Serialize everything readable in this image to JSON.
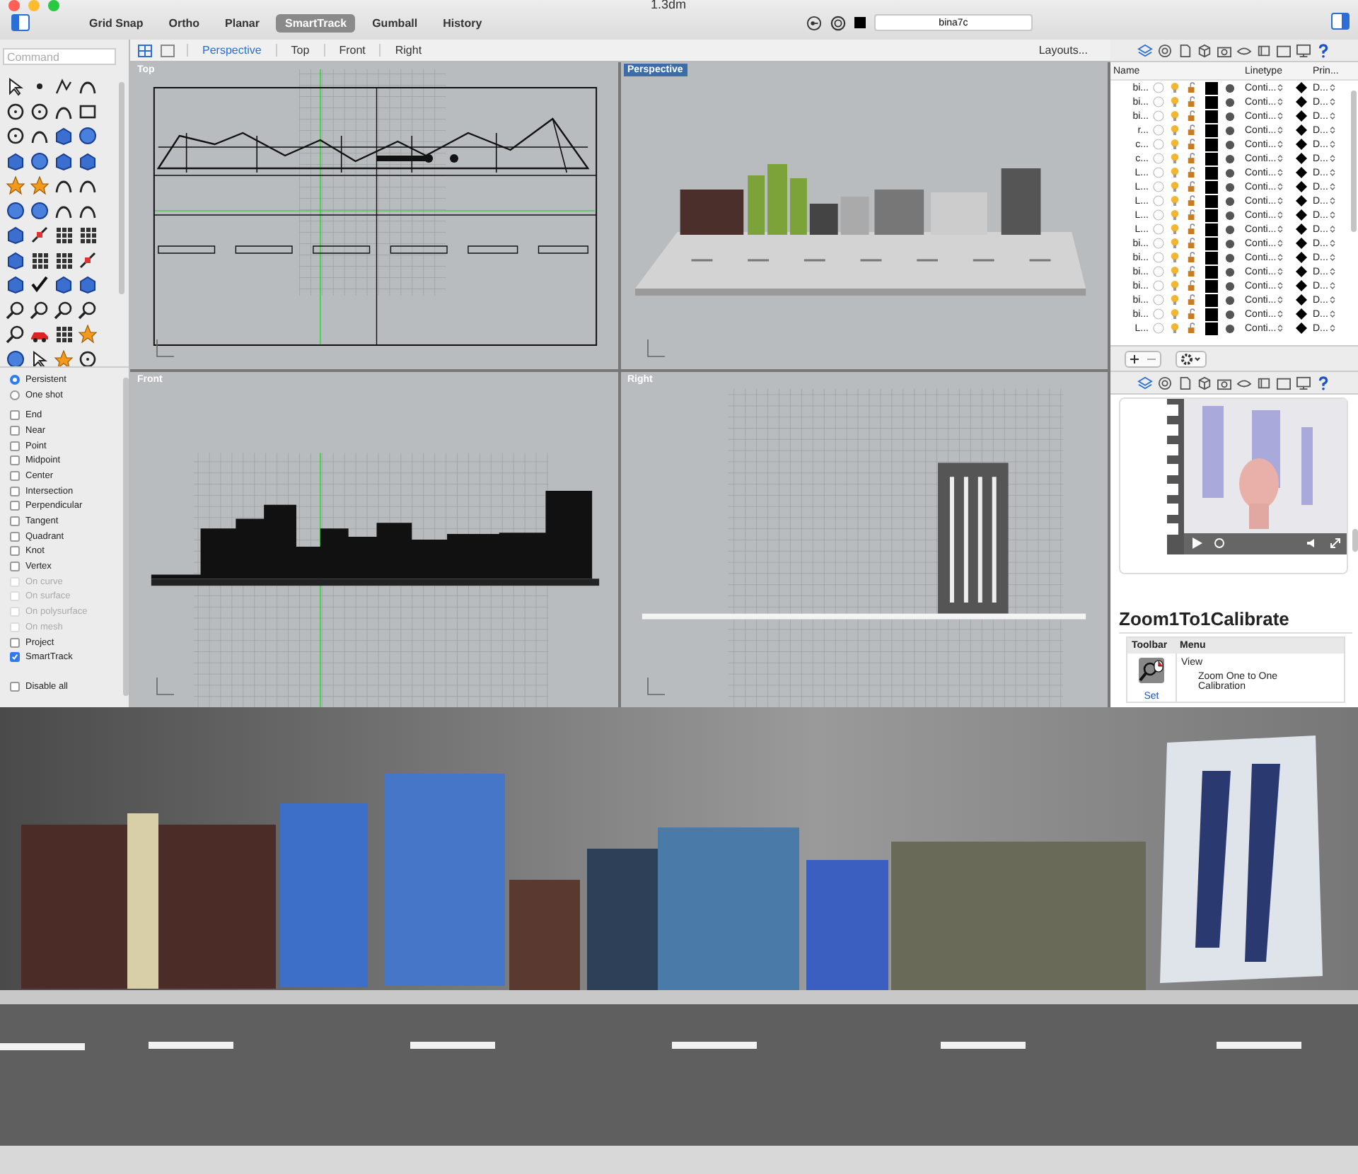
{
  "window": {
    "title": "1.3dm"
  },
  "toolbar": {
    "toggles": [
      {
        "label": "Grid Snap",
        "on": false
      },
      {
        "label": "Ortho",
        "on": false
      },
      {
        "label": "Planar",
        "on": false
      },
      {
        "label": "SmartTrack",
        "on": true
      },
      {
        "label": "Gumball",
        "on": false
      },
      {
        "label": "History",
        "on": false
      }
    ],
    "layer_field": {
      "value": "bina7c"
    }
  },
  "view_tabs": [
    {
      "label": "Perspective",
      "selected": true
    },
    {
      "label": "Top",
      "selected": false
    },
    {
      "label": "Front",
      "selected": false
    },
    {
      "label": "Right",
      "selected": false
    }
  ],
  "layouts_button": "Layouts...",
  "command": {
    "placeholder": "Command"
  },
  "osnaps": [
    {
      "kind": "radio",
      "label": "Persistent",
      "selected": true
    },
    {
      "kind": "radio",
      "label": "One shot",
      "selected": false
    },
    {
      "kind": "checkbox",
      "label": "End",
      "checked": false,
      "disabled": false
    },
    {
      "kind": "checkbox",
      "label": "Near",
      "checked": false,
      "disabled": false
    },
    {
      "kind": "checkbox",
      "label": "Point",
      "checked": false,
      "disabled": false
    },
    {
      "kind": "checkbox",
      "label": "Midpoint",
      "checked": false,
      "disabled": false
    },
    {
      "kind": "checkbox",
      "label": "Center",
      "checked": false,
      "disabled": false
    },
    {
      "kind": "checkbox",
      "label": "Intersection",
      "checked": false,
      "disabled": false
    },
    {
      "kind": "checkbox",
      "label": "Perpendicular",
      "checked": false,
      "disabled": false
    },
    {
      "kind": "checkbox",
      "label": "Tangent",
      "checked": false,
      "disabled": false
    },
    {
      "kind": "checkbox",
      "label": "Quadrant",
      "checked": false,
      "disabled": false
    },
    {
      "kind": "checkbox",
      "label": "Knot",
      "checked": false,
      "disabled": false
    },
    {
      "kind": "checkbox",
      "label": "Vertex",
      "checked": false,
      "disabled": false
    },
    {
      "kind": "checkbox",
      "label": "On curve",
      "checked": false,
      "disabled": true
    },
    {
      "kind": "checkbox",
      "label": "On surface",
      "checked": false,
      "disabled": true
    },
    {
      "kind": "checkbox",
      "label": "On polysurface",
      "checked": false,
      "disabled": true
    },
    {
      "kind": "checkbox",
      "label": "On mesh",
      "checked": false,
      "disabled": true
    },
    {
      "kind": "checkbox",
      "label": "Project",
      "checked": false,
      "disabled": false
    },
    {
      "kind": "checkbox",
      "label": "SmartTrack",
      "checked": true,
      "disabled": false
    },
    {
      "kind": "checkbox",
      "label": "Disable all",
      "checked": false,
      "disabled": false
    }
  ],
  "viewports": [
    {
      "title": "Top",
      "kind": "plan",
      "selected": false
    },
    {
      "title": "Perspective",
      "kind": "perspective",
      "selected": true
    },
    {
      "title": "Front",
      "kind": "elevation",
      "selected": false
    },
    {
      "title": "Right",
      "kind": "side",
      "selected": false
    }
  ],
  "layers": {
    "columns": [
      "Name",
      "Linetype",
      "Prin..."
    ],
    "rows": [
      {
        "name": "bi...",
        "linetype": "Conti...",
        "print_width": "D..."
      },
      {
        "name": "bi...",
        "linetype": "Conti...",
        "print_width": "D..."
      },
      {
        "name": "bi...",
        "linetype": "Conti...",
        "print_width": "D..."
      },
      {
        "name": "r...",
        "linetype": "Conti...",
        "print_width": "D..."
      },
      {
        "name": "c...",
        "linetype": "Conti...",
        "print_width": "D..."
      },
      {
        "name": "c...",
        "linetype": "Conti...",
        "print_width": "D..."
      },
      {
        "name": "L...",
        "linetype": "Conti...",
        "print_width": "D..."
      },
      {
        "name": "L...",
        "linetype": "Conti...",
        "print_width": "D..."
      },
      {
        "name": "L...",
        "linetype": "Conti...",
        "print_width": "D..."
      },
      {
        "name": "L...",
        "linetype": "Conti...",
        "print_width": "D..."
      },
      {
        "name": "L...",
        "linetype": "Conti...",
        "print_width": "D..."
      },
      {
        "name": "bi...",
        "linetype": "Conti...",
        "print_width": "D..."
      },
      {
        "name": "bi...",
        "linetype": "Conti...",
        "print_width": "D..."
      },
      {
        "name": "bi...",
        "linetype": "Conti...",
        "print_width": "D..."
      },
      {
        "name": "bi...",
        "linetype": "Conti...",
        "print_width": "D..."
      },
      {
        "name": "bi...",
        "linetype": "Conti...",
        "print_width": "D..."
      },
      {
        "name": "bi...",
        "linetype": "Conti...",
        "print_width": "D..."
      },
      {
        "name": "L...",
        "linetype": "Conti...",
        "print_width": "D..."
      }
    ]
  },
  "help": {
    "title": "Zoom1To1Calibrate",
    "columns": [
      "Toolbar",
      "Menu"
    ],
    "link": "Set",
    "menu": "View",
    "menu_item": "Zoom One to One Calibration"
  }
}
